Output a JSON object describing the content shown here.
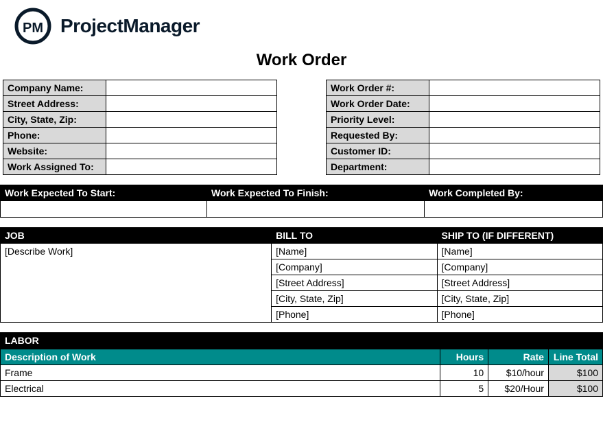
{
  "brand": "ProjectManager",
  "logo_text": "PM",
  "title": "Work Order",
  "company_info": {
    "labels": {
      "company_name": "Company Name:",
      "street_address": "Street Address:",
      "city_state_zip": "City, State, Zip:",
      "phone": "Phone:",
      "website": "Website:",
      "work_assigned_to": "Work Assigned To:"
    },
    "values": {
      "company_name": "",
      "street_address": "",
      "city_state_zip": "",
      "phone": "",
      "website": "",
      "work_assigned_to": ""
    }
  },
  "order_info": {
    "labels": {
      "work_order_num": "Work Order #:",
      "work_order_date": "Work Order Date:",
      "priority_level": "Priority Level:",
      "requested_by": "Requested By:",
      "customer_id": "Customer ID:",
      "department": "Department:"
    },
    "values": {
      "work_order_num": "",
      "work_order_date": "",
      "priority_level": "",
      "requested_by": "",
      "customer_id": "",
      "department": ""
    }
  },
  "timeline": {
    "headers": {
      "start": "Work Expected To Start:",
      "finish": "Work Expected To Finish:",
      "completed": "Work Completed By:"
    },
    "values": {
      "start": "",
      "finish": "",
      "completed": ""
    }
  },
  "job_section": {
    "headers": {
      "job": "JOB",
      "bill_to": "BILL TO",
      "ship_to": "SHIP TO (IF DIFFERENT)"
    },
    "job_desc": "[Describe Work]",
    "bill_to": {
      "name": "[Name]",
      "company": "[Company]",
      "street": "[Street Address]",
      "city": "[City, State, Zip]",
      "phone": "[Phone]"
    },
    "ship_to": {
      "name": "[Name]",
      "company": "[Company]",
      "street": "[Street Address]",
      "city": "[City, State, Zip]",
      "phone": "[Phone]"
    }
  },
  "labor": {
    "title": "LABOR",
    "headers": {
      "desc": "Description of Work",
      "hours": "Hours",
      "rate": "Rate",
      "total": "Line Total"
    },
    "rows": [
      {
        "desc": "Frame",
        "hours": "10",
        "rate": "$10/hour",
        "total": "$100"
      },
      {
        "desc": "Electrical",
        "hours": "5",
        "rate": "$20/Hour",
        "total": "$100"
      }
    ]
  }
}
